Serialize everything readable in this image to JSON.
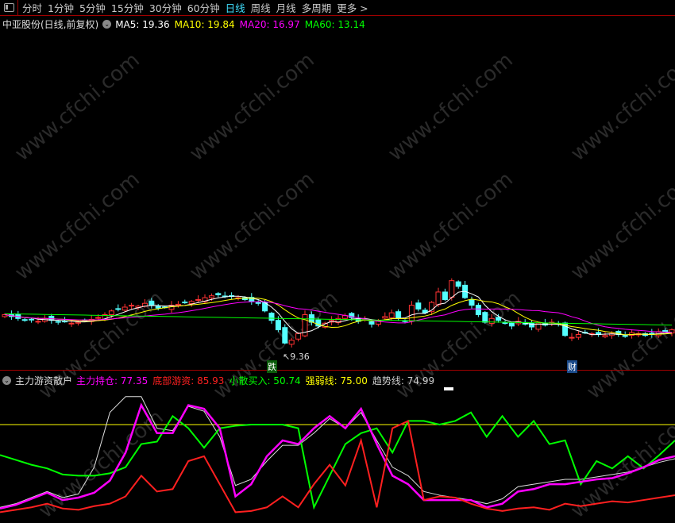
{
  "toolbar": {
    "periods": [
      "分时",
      "1分钟",
      "5分钟",
      "15分钟",
      "30分钟",
      "60分钟",
      "日线",
      "周线",
      "月线",
      "多周期",
      "更多 >"
    ],
    "active": "日线"
  },
  "main": {
    "title": "中亚股份(日线,前复权)",
    "ma": [
      {
        "label": "MA5: 19.36",
        "color": "#ffffff"
      },
      {
        "label": "MA10: 19.84",
        "color": "#ffff00"
      },
      {
        "label": "MA20: 16.97",
        "color": "#ff00ff"
      },
      {
        "label": "MA60: 13.14",
        "color": "#00ff00"
      }
    ],
    "low_label": "9.36",
    "marker_die": "跌",
    "marker_cai": "财",
    "closes": [
      13.6,
      13.4,
      13.2,
      13.0,
      13.1,
      12.9,
      13.2,
      13.0,
      12.8,
      12.9,
      12.7,
      12.8,
      13.0,
      13.1,
      13.3,
      13.6,
      14.0,
      14.2,
      14.4,
      14.6,
      14.5,
      14.8,
      14.6,
      14.3,
      14.4,
      14.6,
      14.7,
      14.9,
      15.0,
      15.2,
      15.4,
      15.6,
      15.7,
      15.5,
      15.6,
      15.4,
      15.2,
      15.0,
      14.8,
      14.0,
      13.0,
      12.0,
      10.6,
      10.9,
      11.6,
      13.6,
      12.8,
      12.4,
      12.7,
      13.0,
      13.2,
      13.5,
      13.3,
      12.9,
      13.1,
      12.6,
      13.0,
      13.4,
      13.8,
      13.2,
      12.9,
      14.6,
      14.2,
      13.8,
      14.9,
      16.0,
      15.2,
      17.2,
      16.6,
      15.4,
      14.6,
      13.6,
      12.8,
      13.2,
      13.0,
      12.7,
      12.4,
      12.9,
      12.6,
      12.3,
      12.7,
      12.5,
      12.8,
      12.6,
      11.4,
      11.2,
      11.5,
      11.7,
      11.6,
      11.5,
      11.4,
      11.6,
      11.5,
      11.3,
      11.7,
      11.6,
      11.4,
      11.5,
      11.8,
      11.9,
      12.0
    ]
  },
  "indicator": {
    "name": "主力游资散户",
    "lines": [
      {
        "label": "主力持仓: 77.35",
        "color": "#ff00ff"
      },
      {
        "label": "底部游资: 85.93",
        "color": "#ff2020"
      },
      {
        "label": "小散买入: 50.74",
        "color": "#00ff00"
      },
      {
        "label": "强弱线: 75.00",
        "color": "#ffff00"
      },
      {
        "label": "趋势线: 74.99",
        "color": "#cccccc"
      }
    ],
    "ylim": [
      0,
      100
    ],
    "strong_level": 75,
    "series": {
      "green": [
        50,
        46,
        42,
        39,
        34,
        33,
        33,
        35,
        40,
        59,
        61,
        82,
        72,
        56,
        72,
        74,
        75,
        75,
        75,
        72,
        7,
        33,
        59,
        68,
        72,
        52,
        78,
        78,
        75,
        78,
        85,
        65,
        82,
        65,
        78,
        59,
        62,
        26,
        45,
        39,
        49,
        39,
        50,
        62
      ],
      "magenta": [
        6,
        9,
        14,
        19,
        13,
        15,
        19,
        29,
        52,
        91,
        68,
        68,
        91,
        88,
        72,
        16,
        26,
        49,
        62,
        59,
        72,
        82,
        72,
        88,
        59,
        33,
        26,
        13,
        13,
        13,
        13,
        7,
        10,
        20,
        22,
        26,
        26,
        28,
        30,
        31,
        35,
        40,
        46,
        49
      ],
      "white": [
        7,
        10,
        15,
        20,
        15,
        18,
        40,
        85,
        98,
        98,
        72,
        70,
        90,
        86,
        65,
        25,
        30,
        45,
        58,
        58,
        68,
        80,
        72,
        85,
        62,
        40,
        33,
        20,
        17,
        15,
        13,
        10,
        14,
        24,
        26,
        28,
        30,
        30,
        32,
        34,
        36,
        40,
        44,
        47
      ],
      "red": [
        3,
        5,
        7,
        10,
        6,
        5,
        8,
        10,
        16,
        33,
        20,
        22,
        45,
        49,
        26,
        3,
        4,
        7,
        16,
        7,
        26,
        42,
        25,
        62,
        7,
        72,
        78,
        13,
        16,
        15,
        10,
        6,
        4,
        6,
        7,
        5,
        10,
        8,
        10,
        12,
        11,
        13,
        15,
        17
      ]
    }
  },
  "watermark": "www.cfchi.com"
}
